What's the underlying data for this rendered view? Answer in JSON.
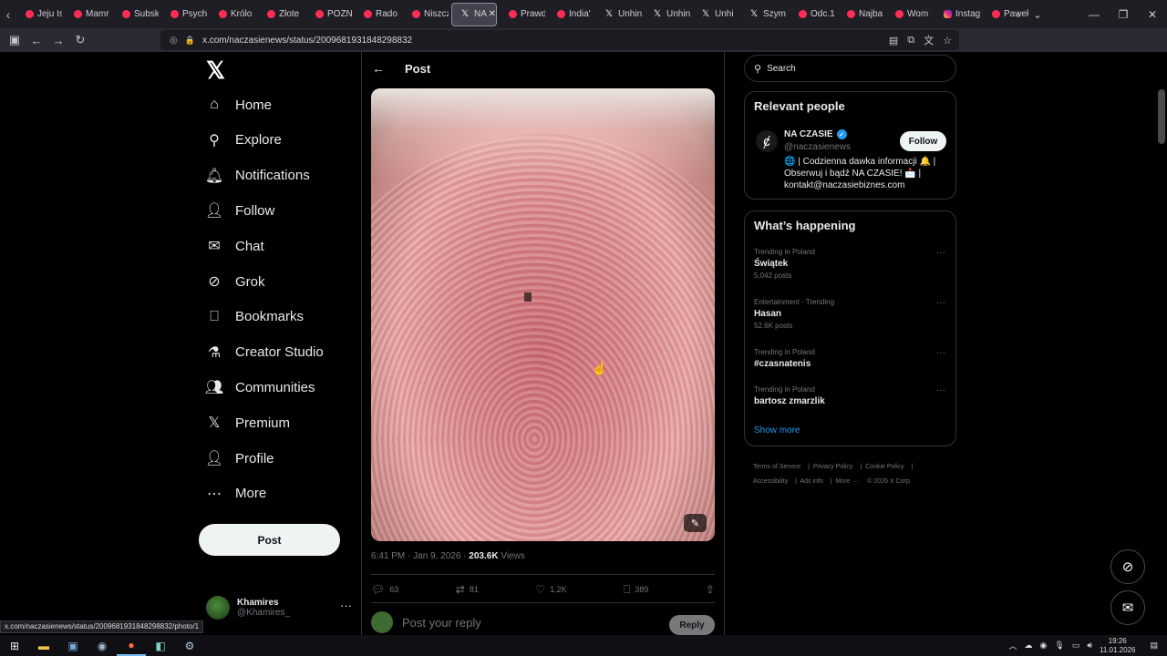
{
  "browser": {
    "tabs": [
      {
        "label": "Jeju Is",
        "icon": "youtube-icon"
      },
      {
        "label": "Mamr",
        "icon": "youtube-icon"
      },
      {
        "label": "Subsk",
        "icon": "youtube-icon"
      },
      {
        "label": "Psych",
        "icon": "youtube-icon"
      },
      {
        "label": "Królo",
        "icon": "youtube-icon"
      },
      {
        "label": "Złote",
        "icon": "youtube-icon"
      },
      {
        "label": "POZN",
        "icon": "youtube-icon"
      },
      {
        "label": "Rado",
        "icon": "youtube-icon"
      },
      {
        "label": "Niszcz",
        "icon": "youtube-icon"
      },
      {
        "label": "NA",
        "icon": "x-icon",
        "active": true
      },
      {
        "label": "Prawd",
        "icon": "youtube-icon"
      },
      {
        "label": "India'",
        "icon": "youtube-icon"
      },
      {
        "label": "Unhin",
        "icon": "x-icon"
      },
      {
        "label": "Unhin",
        "icon": "x-icon"
      },
      {
        "label": "Unhi",
        "icon": "x-icon"
      },
      {
        "label": "Szym",
        "icon": "x-icon"
      },
      {
        "label": "Odc.1",
        "icon": "youtube-icon"
      },
      {
        "label": "Najba",
        "icon": "youtube-icon"
      },
      {
        "label": "Wom",
        "icon": "youtube-icon"
      },
      {
        "label": "Instag",
        "icon": "instagram-icon"
      },
      {
        "label": "Paweł",
        "icon": "youtube-icon"
      }
    ],
    "url": "x.com/naczasienews/status/2009681931848298832",
    "status_url": "x.com/naczasienews/status/2009681931848298832/photo/1"
  },
  "nav": {
    "items": [
      {
        "label": "Home",
        "icon": "home-icon"
      },
      {
        "label": "Explore",
        "icon": "search-icon"
      },
      {
        "label": "Notifications",
        "icon": "bell-icon"
      },
      {
        "label": "Follow",
        "icon": "add-person-icon"
      },
      {
        "label": "Chat",
        "icon": "mail-icon"
      },
      {
        "label": "Grok",
        "icon": "grok-icon"
      },
      {
        "label": "Bookmarks",
        "icon": "bookmark-icon"
      },
      {
        "label": "Creator Studio",
        "icon": "flask-icon"
      },
      {
        "label": "Communities",
        "icon": "people-icon"
      },
      {
        "label": "Premium",
        "icon": "x-icon"
      },
      {
        "label": "Profile",
        "icon": "person-icon"
      },
      {
        "label": "More",
        "icon": "more-icon"
      }
    ],
    "post_label": "Post",
    "account": {
      "name": "Khamires",
      "handle": "@Khamires_"
    }
  },
  "main": {
    "title": "Post",
    "post": {
      "time": "6:41 PM · Jan 9, 2026",
      "views_count": "203.6K",
      "views_label": "Views",
      "replies": "63",
      "reposts": "81",
      "likes": "1.2K",
      "bookmarks": "389"
    },
    "reply_placeholder": "Post your reply",
    "reply_button": "Reply"
  },
  "sidebar": {
    "search_placeholder": "Search",
    "relevant_people": {
      "title": "Relevant people",
      "name": "NA CZASIE",
      "handle": "@naczasienews",
      "follow_label": "Follow",
      "bio": "🌐 | Codzienna dawka informacji 🔔 | Obserwuj i bądź NA CZASIE! 📩 | kontakt@naczasiebiznes.com"
    },
    "whats_happening": {
      "title": "What’s happening",
      "trends": [
        {
          "category": "Trending in Poland",
          "name": "Świątek",
          "posts": "5,042 posts"
        },
        {
          "category": "Entertainment · Trending",
          "name": "Hasan",
          "posts": "52.6K posts"
        },
        {
          "category": "Trending in Poland",
          "name": "#czasnatenis",
          "posts": ""
        },
        {
          "category": "Trending in Poland",
          "name": "bartosz zmarzlik",
          "posts": ""
        }
      ],
      "show_more": "Show more"
    },
    "footer": {
      "terms": "Terms of Service",
      "privacy": "Privacy Policy",
      "cookie": "Cookie Policy",
      "accessibility": "Accessibility",
      "ads": "Ads info",
      "more": "More ···",
      "copyright": "© 2026 X Corp."
    }
  },
  "taskbar": {
    "time": "19:26",
    "date": "11.01.2026"
  },
  "colors": {
    "background": "#000000",
    "accent": "#1d9bf0",
    "border": "#2f3336",
    "muted": "#71767b"
  }
}
